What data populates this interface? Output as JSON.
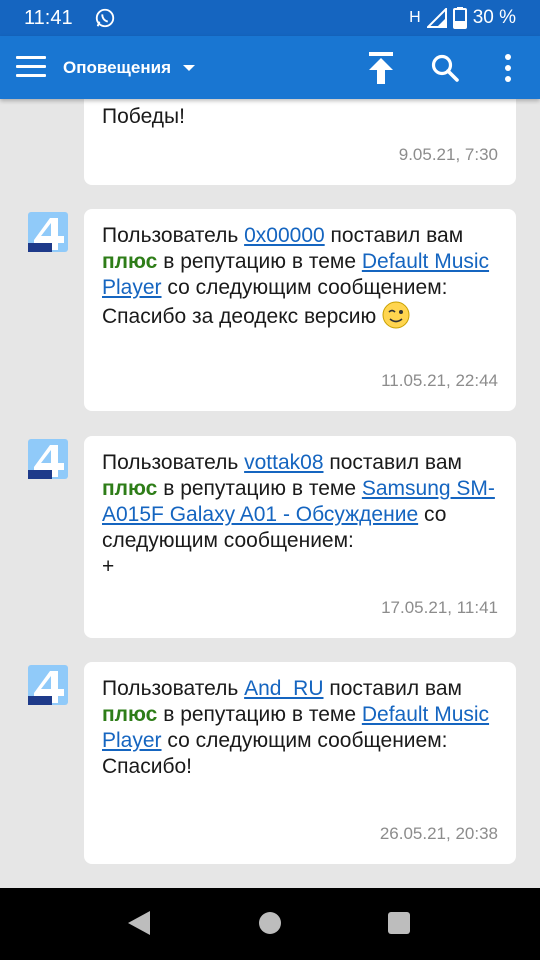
{
  "status": {
    "time": "11:41",
    "network": "H",
    "battery": "30 %"
  },
  "appbar": {
    "title": "Оповещения"
  },
  "cards": [
    {
      "line1": "Победы!",
      "date": "9.05.21, 7:30"
    },
    {
      "prefix": "Пользователь ",
      "user": "0x00000",
      "after_user": " поставил вам",
      "plus": "плюс",
      "mid": " в репутацию в теме ",
      "topic": "Default Music Player",
      "after_topic": " со следующим сообщением:",
      "message": "Спасибо за деодекс версию",
      "date": "11.05.21, 22:44"
    },
    {
      "prefix": "Пользователь ",
      "user": "vottak08",
      "after_user": " поставил вам",
      "plus": "плюс",
      "mid": " в репутацию в теме ",
      "topic": "Samsung SM-A015F Galaxy A01 - Обсуждение",
      "after_topic": " со следующим сообщением:",
      "message": "+",
      "date": "17.05.21, 11:41"
    },
    {
      "prefix": "Пользователь ",
      "user": "And_RU",
      "after_user": " поставил вам",
      "plus": "плюс",
      "mid": " в репутацию в теме ",
      "topic": "Default Music Player",
      "after_topic": " со следующим сообщением:",
      "message": "Спасибо!",
      "date": "26.05.21, 20:38"
    }
  ],
  "icons": [
    "whatsapp-icon",
    "signal-icon",
    "battery-icon",
    "menu-icon",
    "scroll-top-icon",
    "search-icon",
    "more-icon",
    "app-logo-icon",
    "wink-emoji-icon",
    "back-icon",
    "home-icon",
    "recents-icon"
  ],
  "colors": {
    "primary": "#1976d2",
    "status_bar": "#1565c0",
    "link": "#1565c0",
    "plus": "#2e7d18",
    "background": "#e6e6e6"
  }
}
